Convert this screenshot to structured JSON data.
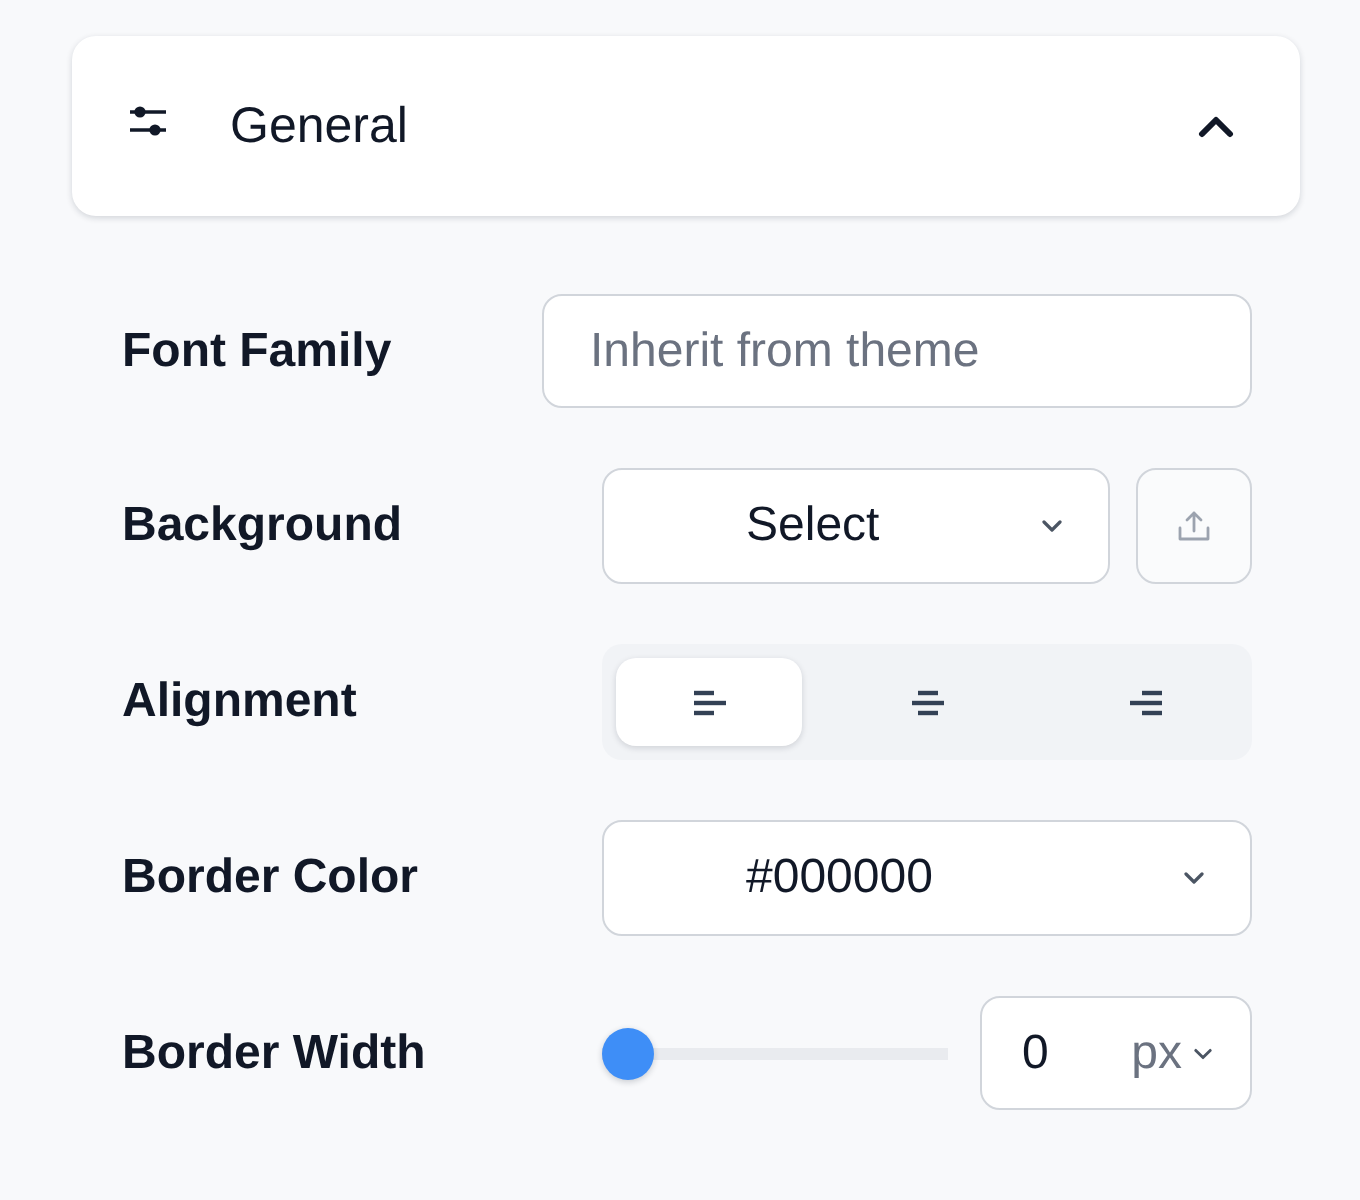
{
  "panel": {
    "title": "General",
    "expanded": true
  },
  "fields": [
    {
      "kind": "text",
      "label": "Font Family",
      "placeholder": "Inherit from theme"
    },
    {
      "kind": "select-upload",
      "label": "Background",
      "value": "Select"
    },
    {
      "kind": "align",
      "label": "Alignment",
      "options": [
        {
          "kind": "left",
          "selected": true
        },
        {
          "kind": "center",
          "selected": false
        },
        {
          "kind": "right",
          "selected": false
        }
      ]
    },
    {
      "kind": "select",
      "label": "Border Color",
      "value": "#000000"
    },
    {
      "kind": "slider",
      "label": "Border Width",
      "level": 0,
      "value": "0",
      "unit": "px"
    }
  ]
}
